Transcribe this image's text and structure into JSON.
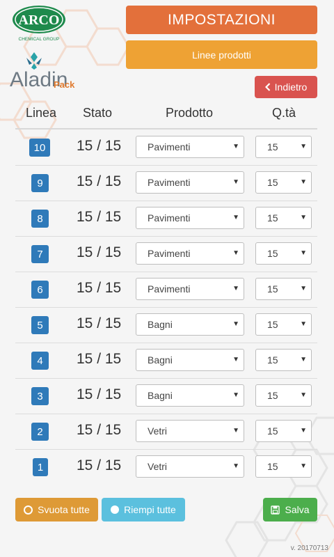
{
  "brand": {
    "arco_name": "ARCO",
    "arco_sub": "CHEMICAL GROUP",
    "aladin_name": "Aladin",
    "aladin_pack": "Pack"
  },
  "header": {
    "title": "IMPOSTAZIONI",
    "subtitle": "Linee prodotti",
    "back_label": "Indietro"
  },
  "table": {
    "columns": [
      "Linea",
      "Stato",
      "Prodotto",
      "Q.tà"
    ],
    "rows": [
      {
        "line": "10",
        "stato": "15 / 15",
        "prodotto": "Pavimenti",
        "qty": "15"
      },
      {
        "line": "9",
        "stato": "15 / 15",
        "prodotto": "Pavimenti",
        "qty": "15"
      },
      {
        "line": "8",
        "stato": "15 / 15",
        "prodotto": "Pavimenti",
        "qty": "15"
      },
      {
        "line": "7",
        "stato": "15 / 15",
        "prodotto": "Pavimenti",
        "qty": "15"
      },
      {
        "line": "6",
        "stato": "15 / 15",
        "prodotto": "Pavimenti",
        "qty": "15"
      },
      {
        "line": "5",
        "stato": "15 / 15",
        "prodotto": "Bagni",
        "qty": "15"
      },
      {
        "line": "4",
        "stato": "15 / 15",
        "prodotto": "Bagni",
        "qty": "15"
      },
      {
        "line": "3",
        "stato": "15 / 15",
        "prodotto": "Bagni",
        "qty": "15"
      },
      {
        "line": "2",
        "stato": "15 / 15",
        "prodotto": "Vetri",
        "qty": "15"
      },
      {
        "line": "1",
        "stato": "15 / 15",
        "prodotto": "Vetri",
        "qty": "15"
      }
    ]
  },
  "footer": {
    "empty_all": "Svuota tutte",
    "fill_all": "Riempi tutte",
    "save": "Salva",
    "version": "v. 20170713"
  },
  "icons": {
    "back": "chevron-left-icon",
    "empty_all": "circle-outline-icon",
    "fill_all": "circle-filled-icon",
    "save": "floppy-disk-icon",
    "dropdown": "caret-down-icon"
  },
  "colors": {
    "title_bg": "#e3703b",
    "subtitle_bg": "#eea234",
    "back_bg": "#d9534f",
    "badge_bg": "#2f7ab9",
    "empty_all_bg": "#de9a36",
    "fill_all_bg": "#5bc0de",
    "save_bg": "#4cae4c",
    "arco_green": "#1e8a4c"
  }
}
